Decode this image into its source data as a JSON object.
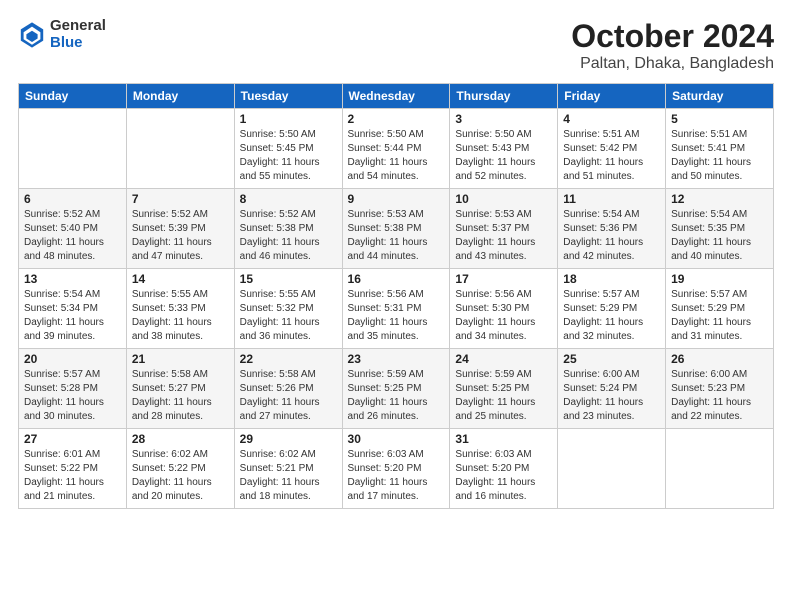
{
  "logo": {
    "general": "General",
    "blue": "Blue"
  },
  "title": "October 2024",
  "subtitle": "Paltan, Dhaka, Bangladesh",
  "days_of_week": [
    "Sunday",
    "Monday",
    "Tuesday",
    "Wednesday",
    "Thursday",
    "Friday",
    "Saturday"
  ],
  "weeks": [
    [
      {
        "day": "",
        "detail": ""
      },
      {
        "day": "",
        "detail": ""
      },
      {
        "day": "1",
        "detail": "Sunrise: 5:50 AM\nSunset: 5:45 PM\nDaylight: 11 hours and 55 minutes."
      },
      {
        "day": "2",
        "detail": "Sunrise: 5:50 AM\nSunset: 5:44 PM\nDaylight: 11 hours and 54 minutes."
      },
      {
        "day": "3",
        "detail": "Sunrise: 5:50 AM\nSunset: 5:43 PM\nDaylight: 11 hours and 52 minutes."
      },
      {
        "day": "4",
        "detail": "Sunrise: 5:51 AM\nSunset: 5:42 PM\nDaylight: 11 hours and 51 minutes."
      },
      {
        "day": "5",
        "detail": "Sunrise: 5:51 AM\nSunset: 5:41 PM\nDaylight: 11 hours and 50 minutes."
      }
    ],
    [
      {
        "day": "6",
        "detail": "Sunrise: 5:52 AM\nSunset: 5:40 PM\nDaylight: 11 hours and 48 minutes."
      },
      {
        "day": "7",
        "detail": "Sunrise: 5:52 AM\nSunset: 5:39 PM\nDaylight: 11 hours and 47 minutes."
      },
      {
        "day": "8",
        "detail": "Sunrise: 5:52 AM\nSunset: 5:38 PM\nDaylight: 11 hours and 46 minutes."
      },
      {
        "day": "9",
        "detail": "Sunrise: 5:53 AM\nSunset: 5:38 PM\nDaylight: 11 hours and 44 minutes."
      },
      {
        "day": "10",
        "detail": "Sunrise: 5:53 AM\nSunset: 5:37 PM\nDaylight: 11 hours and 43 minutes."
      },
      {
        "day": "11",
        "detail": "Sunrise: 5:54 AM\nSunset: 5:36 PM\nDaylight: 11 hours and 42 minutes."
      },
      {
        "day": "12",
        "detail": "Sunrise: 5:54 AM\nSunset: 5:35 PM\nDaylight: 11 hours and 40 minutes."
      }
    ],
    [
      {
        "day": "13",
        "detail": "Sunrise: 5:54 AM\nSunset: 5:34 PM\nDaylight: 11 hours and 39 minutes."
      },
      {
        "day": "14",
        "detail": "Sunrise: 5:55 AM\nSunset: 5:33 PM\nDaylight: 11 hours and 38 minutes."
      },
      {
        "day": "15",
        "detail": "Sunrise: 5:55 AM\nSunset: 5:32 PM\nDaylight: 11 hours and 36 minutes."
      },
      {
        "day": "16",
        "detail": "Sunrise: 5:56 AM\nSunset: 5:31 PM\nDaylight: 11 hours and 35 minutes."
      },
      {
        "day": "17",
        "detail": "Sunrise: 5:56 AM\nSunset: 5:30 PM\nDaylight: 11 hours and 34 minutes."
      },
      {
        "day": "18",
        "detail": "Sunrise: 5:57 AM\nSunset: 5:29 PM\nDaylight: 11 hours and 32 minutes."
      },
      {
        "day": "19",
        "detail": "Sunrise: 5:57 AM\nSunset: 5:29 PM\nDaylight: 11 hours and 31 minutes."
      }
    ],
    [
      {
        "day": "20",
        "detail": "Sunrise: 5:57 AM\nSunset: 5:28 PM\nDaylight: 11 hours and 30 minutes."
      },
      {
        "day": "21",
        "detail": "Sunrise: 5:58 AM\nSunset: 5:27 PM\nDaylight: 11 hours and 28 minutes."
      },
      {
        "day": "22",
        "detail": "Sunrise: 5:58 AM\nSunset: 5:26 PM\nDaylight: 11 hours and 27 minutes."
      },
      {
        "day": "23",
        "detail": "Sunrise: 5:59 AM\nSunset: 5:25 PM\nDaylight: 11 hours and 26 minutes."
      },
      {
        "day": "24",
        "detail": "Sunrise: 5:59 AM\nSunset: 5:25 PM\nDaylight: 11 hours and 25 minutes."
      },
      {
        "day": "25",
        "detail": "Sunrise: 6:00 AM\nSunset: 5:24 PM\nDaylight: 11 hours and 23 minutes."
      },
      {
        "day": "26",
        "detail": "Sunrise: 6:00 AM\nSunset: 5:23 PM\nDaylight: 11 hours and 22 minutes."
      }
    ],
    [
      {
        "day": "27",
        "detail": "Sunrise: 6:01 AM\nSunset: 5:22 PM\nDaylight: 11 hours and 21 minutes."
      },
      {
        "day": "28",
        "detail": "Sunrise: 6:02 AM\nSunset: 5:22 PM\nDaylight: 11 hours and 20 minutes."
      },
      {
        "day": "29",
        "detail": "Sunrise: 6:02 AM\nSunset: 5:21 PM\nDaylight: 11 hours and 18 minutes."
      },
      {
        "day": "30",
        "detail": "Sunrise: 6:03 AM\nSunset: 5:20 PM\nDaylight: 11 hours and 17 minutes."
      },
      {
        "day": "31",
        "detail": "Sunrise: 6:03 AM\nSunset: 5:20 PM\nDaylight: 11 hours and 16 minutes."
      },
      {
        "day": "",
        "detail": ""
      },
      {
        "day": "",
        "detail": ""
      }
    ]
  ]
}
